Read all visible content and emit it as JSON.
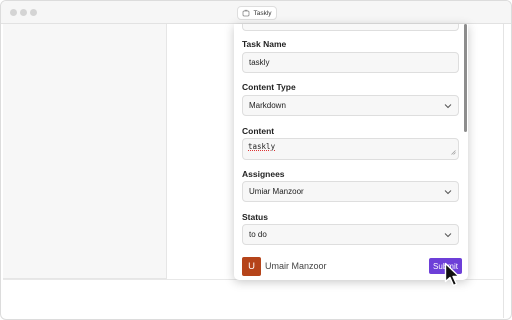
{
  "window": {
    "title": "Taskly"
  },
  "form": {
    "task_name": {
      "label": "Task Name",
      "value": "taskly"
    },
    "content_type": {
      "label": "Content Type",
      "value": "Markdown"
    },
    "content": {
      "label": "Content",
      "value": "taskly"
    },
    "assignees": {
      "label": "Assignees",
      "value": "Umiar Manzoor"
    },
    "status": {
      "label": "Status",
      "value": "to do"
    }
  },
  "footer": {
    "avatar_initial": "U",
    "user_name": "Umair Manzoor",
    "submit_label": "Submit"
  },
  "colors": {
    "accent": "#6d3fd8",
    "avatar": "#b5441a"
  },
  "icons": [
    "app-icon",
    "chevron-down-icon",
    "resize-handle-icon",
    "cursor-pointer-icon"
  ]
}
